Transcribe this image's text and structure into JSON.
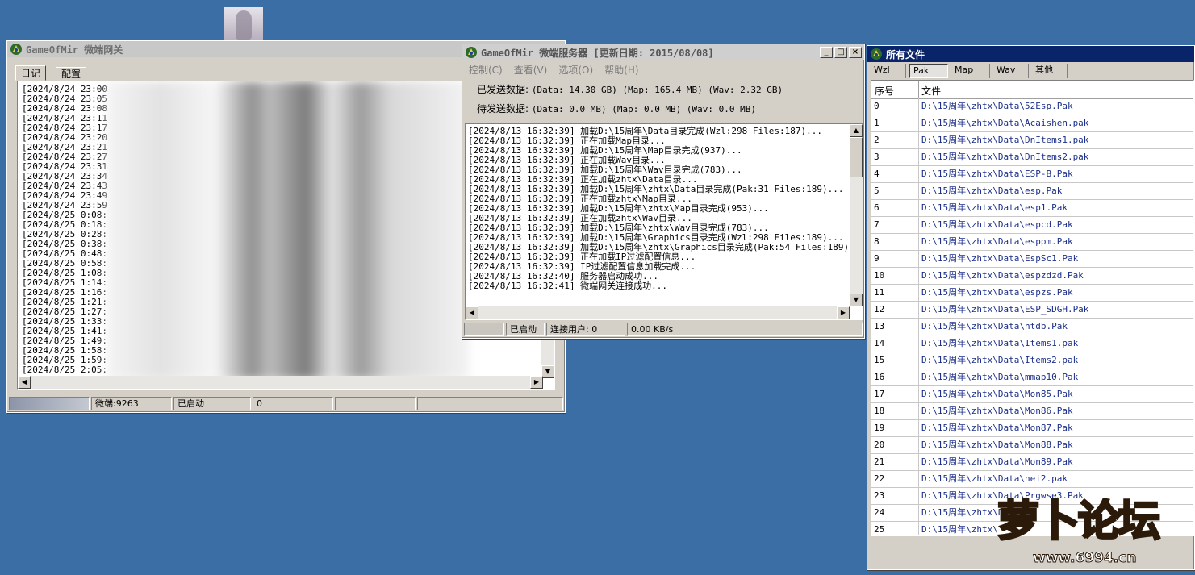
{
  "desktop": {
    "background": "#3b6ea5"
  },
  "gateway_window": {
    "title": "GameOfMir 微端网关",
    "tabs": [
      "日记",
      "配置"
    ],
    "log_lines": [
      "[2024/8/24 23:00",
      "[2024/8/24 23:05",
      "[2024/8/24 23:08",
      "[2024/8/24 23:11",
      "[2024/8/24 23:17",
      "[2024/8/24 23:20",
      "[2024/8/24 23:21",
      "[2024/8/24 23:27",
      "[2024/8/24 23:31",
      "[2024/8/24 23:34",
      "[2024/8/24 23:43",
      "[2024/8/24 23:49",
      "[2024/8/24 23:59",
      "[2024/8/25 0:08:",
      "[2024/8/25 0:18:",
      "[2024/8/25 0:28:",
      "[2024/8/25 0:38:",
      "[2024/8/25 0:48:",
      "[2024/8/25 0:58:",
      "[2024/8/25 1:08:",
      "[2024/8/25 1:14:",
      "[2024/8/25 1:16:",
      "[2024/8/25 1:21:",
      "[2024/8/25 1:27:",
      "[2024/8/25 1:33:",
      "[2024/8/25 1:41:",
      "[2024/8/25 1:49:",
      "[2024/8/25 1:58:",
      "[2024/8/25 1:59:",
      "[2024/8/25 2:05:"
    ],
    "status": [
      "",
      "微端:9263",
      "已启动",
      "0",
      "",
      ""
    ]
  },
  "server_window": {
    "title": "GameOfMir 微端服务器 [更新日期: 2015/08/08]",
    "menu": [
      "控制(C)",
      "查看(V)",
      "选项(O)",
      "帮助(H)"
    ],
    "sent_label": "已发送数据:",
    "sent_value": "(Data: 14.30 GB)  (Map: 165.4 MB)  (Wav: 2.32 GB)",
    "pending_label": "待发送数据:",
    "pending_value": "(Data: 0.0 MB)  (Map: 0.0 MB)  (Wav: 0.0 MB)",
    "log_lines": [
      "[2024/8/13 16:32:39] 加载D:\\15周年\\Data目录完成(Wzl:298 Files:187)...",
      "[2024/8/13 16:32:39] 正在加载Map目录...",
      "[2024/8/13 16:32:39] 加载D:\\15周年\\Map目录完成(937)...",
      "[2024/8/13 16:32:39] 正在加载Wav目录...",
      "[2024/8/13 16:32:39] 加载D:\\15周年\\Wav目录完成(783)...",
      "[2024/8/13 16:32:39] 正在加载zhtx\\Data目录...",
      "[2024/8/13 16:32:39] 加载D:\\15周年\\zhtx\\Data目录完成(Pak:31 Files:189)...",
      "[2024/8/13 16:32:39] 正在加载zhtx\\Map目录...",
      "[2024/8/13 16:32:39] 加载D:\\15周年\\zhtx\\Map目录完成(953)...",
      "[2024/8/13 16:32:39] 正在加载zhtx\\Wav目录...",
      "[2024/8/13 16:32:39] 加载D:\\15周年\\zhtx\\Wav目录完成(783)...",
      "[2024/8/13 16:32:39] 加载D:\\15周年\\Graphics目录完成(Wzl:298 Files:189)...",
      "[2024/8/13 16:32:39] 加载D:\\15周年\\zhtx\\Graphics目录完成(Pak:54 Files:189)...",
      "[2024/8/13 16:32:39] 正在加载IP过滤配置信息...",
      "[2024/8/13 16:32:39] IP过滤配置信息加载完成...",
      "[2024/8/13 16:32:40] 服务器启动成功...",
      "[2024/8/13 16:32:41] 微端网关连接成功..."
    ],
    "status": [
      "",
      "已启动",
      "连接用户: 0",
      "0.00 KB/s"
    ]
  },
  "files_window": {
    "title": "所有文件",
    "tabs": [
      "Wzl",
      "Pak",
      "Map",
      "Wav",
      "其他"
    ],
    "selected_tab": "Pak",
    "columns": [
      "序号",
      "文件"
    ],
    "rows": [
      [
        "0",
        "D:\\15周年\\zhtx\\Data\\52Esp.Pak"
      ],
      [
        "1",
        "D:\\15周年\\zhtx\\Data\\Acaishen.pak"
      ],
      [
        "2",
        "D:\\15周年\\zhtx\\Data\\DnItems1.pak"
      ],
      [
        "3",
        "D:\\15周年\\zhtx\\Data\\DnItems2.pak"
      ],
      [
        "4",
        "D:\\15周年\\zhtx\\Data\\ESP-B.Pak"
      ],
      [
        "5",
        "D:\\15周年\\zhtx\\Data\\esp.Pak"
      ],
      [
        "6",
        "D:\\15周年\\zhtx\\Data\\esp1.Pak"
      ],
      [
        "7",
        "D:\\15周年\\zhtx\\Data\\espcd.Pak"
      ],
      [
        "8",
        "D:\\15周年\\zhtx\\Data\\esppm.Pak"
      ],
      [
        "9",
        "D:\\15周年\\zhtx\\Data\\EspSc1.Pak"
      ],
      [
        "10",
        "D:\\15周年\\zhtx\\Data\\espzdzd.Pak"
      ],
      [
        "11",
        "D:\\15周年\\zhtx\\Data\\espzs.Pak"
      ],
      [
        "12",
        "D:\\15周年\\zhtx\\Data\\ESP_SDGH.Pak"
      ],
      [
        "13",
        "D:\\15周年\\zhtx\\Data\\htdb.Pak"
      ],
      [
        "14",
        "D:\\15周年\\zhtx\\Data\\Items1.pak"
      ],
      [
        "15",
        "D:\\15周年\\zhtx\\Data\\Items2.pak"
      ],
      [
        "16",
        "D:\\15周年\\zhtx\\Data\\mmap10.Pak"
      ],
      [
        "17",
        "D:\\15周年\\zhtx\\Data\\Mon85.Pak"
      ],
      [
        "18",
        "D:\\15周年\\zhtx\\Data\\Mon86.Pak"
      ],
      [
        "19",
        "D:\\15周年\\zhtx\\Data\\Mon87.Pak"
      ],
      [
        "20",
        "D:\\15周年\\zhtx\\Data\\Mon88.Pak"
      ],
      [
        "21",
        "D:\\15周年\\zhtx\\Data\\Mon89.Pak"
      ],
      [
        "22",
        "D:\\15周年\\zhtx\\Data\\nei2.pak"
      ],
      [
        "23",
        "D:\\15周年\\zhtx\\Data\\Prgwse3.Pak"
      ],
      [
        "24",
        "D:\\15周年\\zhtx\\Da"
      ],
      [
        "25",
        "D:\\15周年\\zhtx\\"
      ]
    ]
  },
  "watermark": {
    "text": "萝卜论坛",
    "url_text": "www.6994.cn"
  }
}
